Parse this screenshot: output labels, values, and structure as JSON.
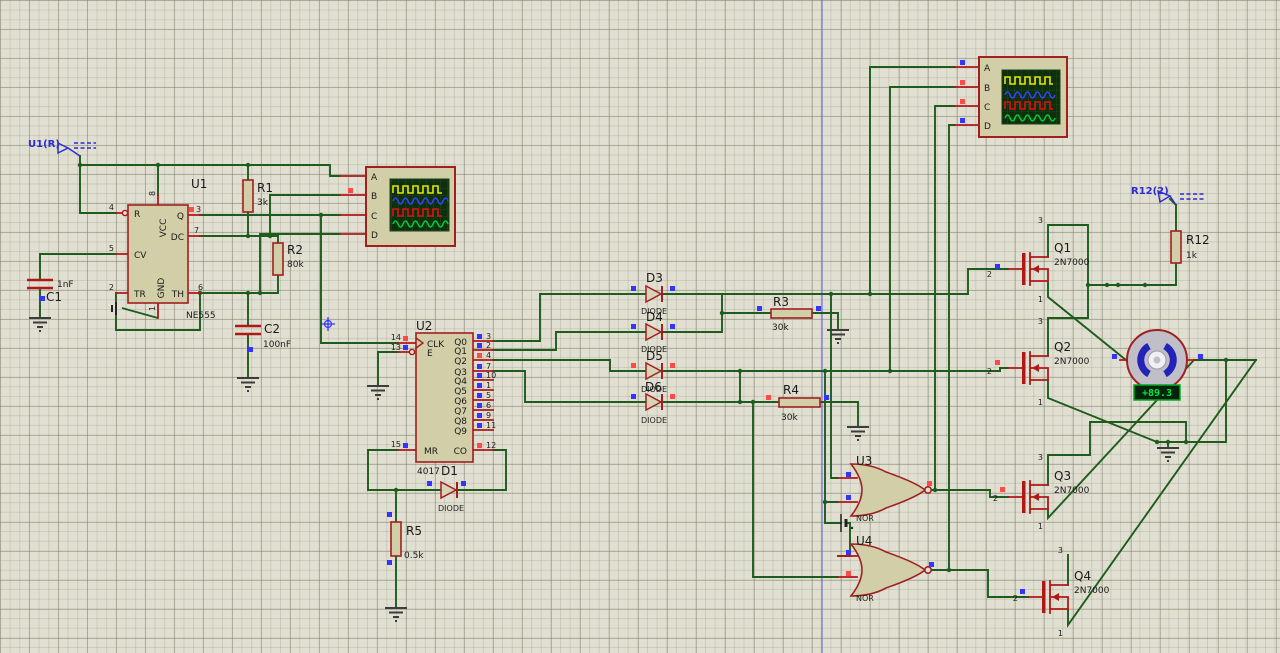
{
  "colors": {
    "wire": "#1d5c1d",
    "pin_red": "#b01818",
    "body_fill": "#d2cea8",
    "outline_red": "#a02020",
    "probe_blue": "#2b2bd0",
    "square_blue": "#3434ff",
    "square_red": "#ff4a4a",
    "screen_bg": "#0e2e0e",
    "wave_yellow": "#e6e600",
    "wave_blue": "#3344ff",
    "wave_red": "#e01010",
    "wave_green": "#00cc33",
    "led_green": "#00ee44",
    "sheet_border": "#7070cc"
  },
  "probes": {
    "left": "U1(R)",
    "right": "R12(2)"
  },
  "u1": {
    "ref": "U1",
    "part": "NE555",
    "pins": {
      "r_num": "4",
      "r": "R",
      "cv_num": "5",
      "cv": "CV",
      "tr_num": "2",
      "tr": "TR",
      "q_num": "3",
      "q": "Q",
      "dc_num": "7",
      "dc": "DC",
      "th_num": "6",
      "th": "TH",
      "vcc_num": "8",
      "vcc": "VCC",
      "gnd_num": "1",
      "gnd": "GND"
    }
  },
  "resistors": {
    "r1": {
      "ref": "R1",
      "value": "3k"
    },
    "r2": {
      "ref": "R2",
      "value": "80k"
    },
    "r3": {
      "ref": "R3",
      "value": "30k"
    },
    "r4": {
      "ref": "R4",
      "value": "30k"
    },
    "r5": {
      "ref": "R5",
      "value": "0.5k"
    },
    "r12": {
      "ref": "R12",
      "value": "1k"
    }
  },
  "capacitors": {
    "c1": {
      "ref": "C1",
      "value": "1nF"
    },
    "c2": {
      "ref": "C2",
      "value": "100nF"
    }
  },
  "u2": {
    "ref": "U2",
    "part": "4017",
    "left": [
      {
        "num": "14",
        "label": "CLK"
      },
      {
        "num": "13",
        "label": "E"
      },
      {
        "num": "15",
        "label": "MR"
      }
    ],
    "right": [
      {
        "num": "3",
        "label": "Q0"
      },
      {
        "num": "2",
        "label": "Q1"
      },
      {
        "num": "4",
        "label": "Q2"
      },
      {
        "num": "7",
        "label": "Q3"
      },
      {
        "num": "10",
        "label": "Q4"
      },
      {
        "num": "1",
        "label": "Q5"
      },
      {
        "num": "5",
        "label": "Q6"
      },
      {
        "num": "6",
        "label": "Q7"
      },
      {
        "num": "9",
        "label": "Q8"
      },
      {
        "num": "11",
        "label": "Q9"
      },
      {
        "num": "12",
        "label": "CO"
      }
    ]
  },
  "diodes": {
    "d1": {
      "ref": "D1",
      "value": "DIODE"
    },
    "d3": {
      "ref": "D3",
      "value": "DIODE"
    },
    "d4": {
      "ref": "D4",
      "value": "DIODE"
    },
    "d5": {
      "ref": "D5",
      "value": "DIODE"
    },
    "d6": {
      "ref": "D6",
      "value": "DIODE"
    }
  },
  "gates": {
    "u3": {
      "ref": "U3",
      "type": "NOR"
    },
    "u4": {
      "ref": "U4",
      "type": "NOR"
    }
  },
  "mosfets": {
    "q1": {
      "ref": "Q1",
      "part": "2N7000",
      "drain": "3",
      "gate": "2",
      "source": "1"
    },
    "q2": {
      "ref": "Q2",
      "part": "2N7000",
      "drain": "3",
      "gate": "2",
      "source": "1"
    },
    "q3": {
      "ref": "Q3",
      "part": "2N7000",
      "drain": "3",
      "gate": "2",
      "source": "1"
    },
    "q4": {
      "ref": "Q4",
      "part": "2N7000",
      "drain": "3",
      "gate": "2",
      "source": "1"
    }
  },
  "motor": {
    "reading": "+89.3"
  },
  "scope1": {
    "channels": [
      "A",
      "B",
      "C",
      "D"
    ]
  },
  "scope2": {
    "channels": [
      "A",
      "B",
      "C",
      "D"
    ]
  }
}
